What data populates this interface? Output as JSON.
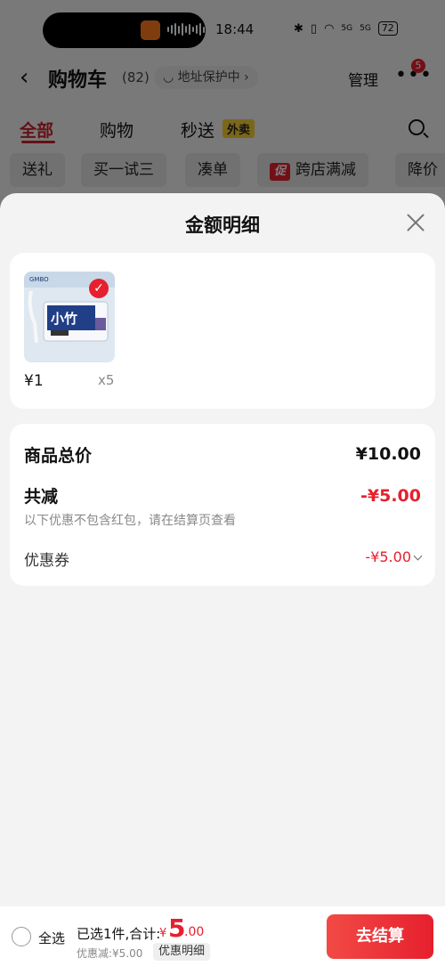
{
  "status_bar": {
    "time": "18:44",
    "battery": "72",
    "signal_labels": [
      "5G",
      "5G"
    ]
  },
  "header": {
    "back_icon": "chevron-left-icon",
    "title": "购物车",
    "count": "(82)",
    "address_protection": "地址保护中",
    "manage": "管理",
    "more_badge": "5"
  },
  "tabs": {
    "items": [
      "全部",
      "购物",
      "秒送"
    ],
    "active_index": 0,
    "waimai_badge": "外卖"
  },
  "chips": {
    "items": [
      "送礼",
      "买一试三",
      "凑单",
      "跨店满减",
      "降价"
    ],
    "promo_tag": "促"
  },
  "sheet": {
    "title": "金额明细",
    "product": {
      "thumb_brand": "小竹",
      "price": "¥1",
      "quantity": "x5"
    },
    "summary": {
      "total_label": "商品总价",
      "total_value": "¥10.00",
      "reduction_label": "共减",
      "reduction_value": "-¥5.00",
      "note": "以下优惠不包含红包，请在结算页查看",
      "coupon_label": "优惠券",
      "coupon_value": "-¥5.00"
    }
  },
  "bottom_bar": {
    "select_all": "全选",
    "selected_text": "已选1件,合计:",
    "currency": "¥",
    "total_int": "5",
    "total_dec": ".00",
    "discount": "优惠减:¥5.00",
    "detail_button": "优惠明细",
    "checkout_button": "去结算"
  },
  "colors": {
    "accent_red": "#e6202e",
    "tab_active": "#c9222a",
    "waimai_yellow": "#f5cf33"
  }
}
